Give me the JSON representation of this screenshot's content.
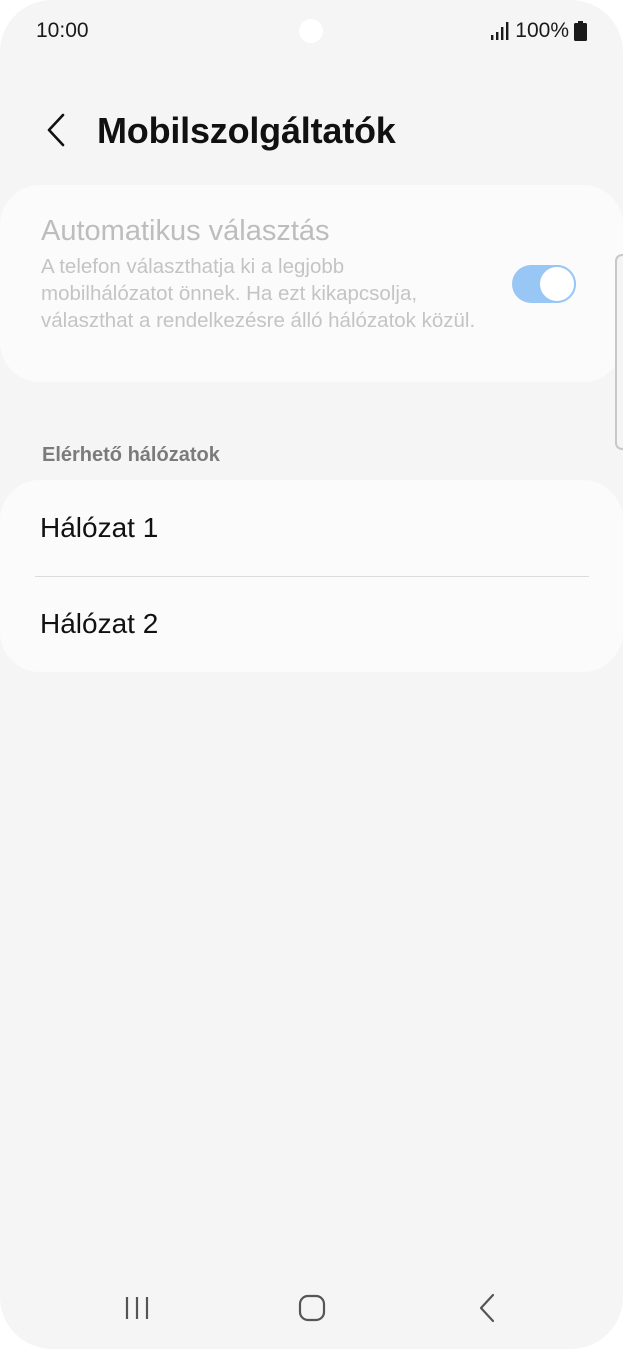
{
  "status_bar": {
    "time": "10:00",
    "battery": "100%",
    "icons": [
      "signal-icon",
      "battery-icon"
    ]
  },
  "header": {
    "back_icon": "chevron-left-icon",
    "title": "Mobilszolgáltatók"
  },
  "auto_select": {
    "title": "Automatikus választás",
    "description": "A telefon választhatja ki a legjobb mobilhálózatot önnek. Ha ezt kikapcsolja, választhat a rendelkezésre álló hálózatok közül.",
    "enabled": true,
    "disabled_appearance": true,
    "toggle_color": "#98c7f5"
  },
  "networks": {
    "section_title": "Elérhető hálózatok",
    "items": [
      {
        "label": "Hálózat 1"
      },
      {
        "label": "Hálózat 2"
      }
    ]
  },
  "nav_bar": {
    "icons": [
      "recents-icon",
      "home-icon",
      "back-icon"
    ]
  }
}
